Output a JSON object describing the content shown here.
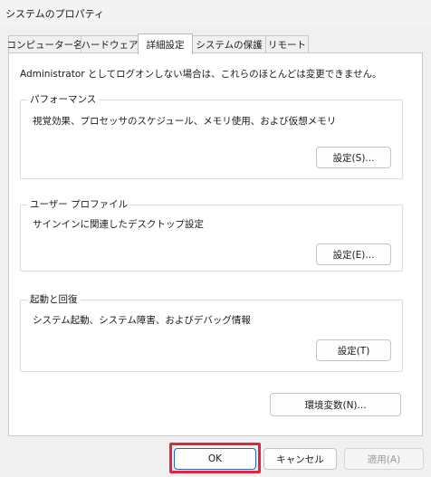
{
  "window": {
    "title": "システムのプロパティ"
  },
  "tabs": [
    {
      "label": "コンピューター名"
    },
    {
      "label": "ハードウェア"
    },
    {
      "label": "詳細設定"
    },
    {
      "label": "システムの保護"
    },
    {
      "label": "リモート"
    }
  ],
  "active_tab": "詳細設定",
  "intro_text": "Administrator としてログオンしない場合は、これらのほとんどは変更できません。",
  "groups": {
    "performance": {
      "legend": "パフォーマンス",
      "description": "視覚効果、プロセッサのスケジュール、メモリ使用、および仮想メモリ",
      "button": "設定(S)..."
    },
    "user_profile": {
      "legend": "ユーザー プロファイル",
      "description": "サインインに関連したデスクトップ設定",
      "button": "設定(E)..."
    },
    "startup_recovery": {
      "legend": "起動と回復",
      "description": "システム起動、システム障害、およびデバッグ情報",
      "button": "設定(T)"
    }
  },
  "env_button": "環境変数(N)...",
  "footer": {
    "ok": "OK",
    "cancel": "キャンセル",
    "apply": "適用(A)"
  },
  "colors": {
    "highlight_border": "#e0263f",
    "primary_border": "#1d68c2"
  }
}
